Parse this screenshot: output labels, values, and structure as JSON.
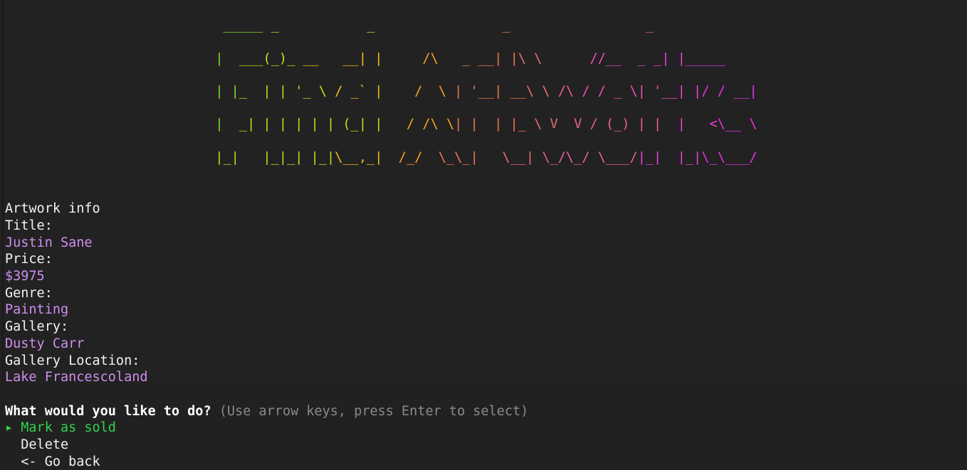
{
  "terminal": {
    "background": "#222222",
    "foreground": "#f2f2f2"
  },
  "banner": {
    "text_value": "Find Artworks",
    "style": "figlet-ascii-art",
    "gradient_from": "#7ddc28",
    "gradient_to": "#e832e8",
    "lines": [
      "  _____ _           _                        _                    _        ",
      " |  ___(_)_ __   __| |     /\\   _ __| |\\ \\      //__  _ _| |_____ ",
      " | |_  | | '_ \\ / _` |    /  \\ | '__| __\\ \\ /\\ / / _ \\| '__| |/ / __|",
      " |  _| | | | | | (_| |   / /\\ \\| |  | |_ \\ V  V / (_) | |  |   <\\__ \\",
      " |_|   |_|_| |_|\\__,_|  /_/  \\_\\_|   \\__| \\_/\\_/ \\___/|_|  |_|\\_\\___/"
    ]
  },
  "info": {
    "heading": "Artwork info",
    "fields": [
      {
        "label": "Title:",
        "value": "Justin Sane"
      },
      {
        "label": "Price:",
        "value": "$3975"
      },
      {
        "label": "Genre:",
        "value": "Painting"
      },
      {
        "label": "Gallery:",
        "value": "Dusty Carr"
      },
      {
        "label": "Gallery Location:",
        "value": "Lake Francescoland"
      }
    ],
    "label_color": "#f2f2f2",
    "value_color": "#cf8ef0"
  },
  "prompt": {
    "question": "What would you like to do?",
    "hint": "(Use arrow keys, press Enter to select)",
    "hint_color": "#8a8a8a"
  },
  "menu": {
    "pointer": "▸",
    "selected_index": 0,
    "selected_color": "#2fd34f",
    "items": [
      {
        "label": "Mark as sold"
      },
      {
        "label": "Delete"
      },
      {
        "label": "<- Go back"
      }
    ]
  }
}
